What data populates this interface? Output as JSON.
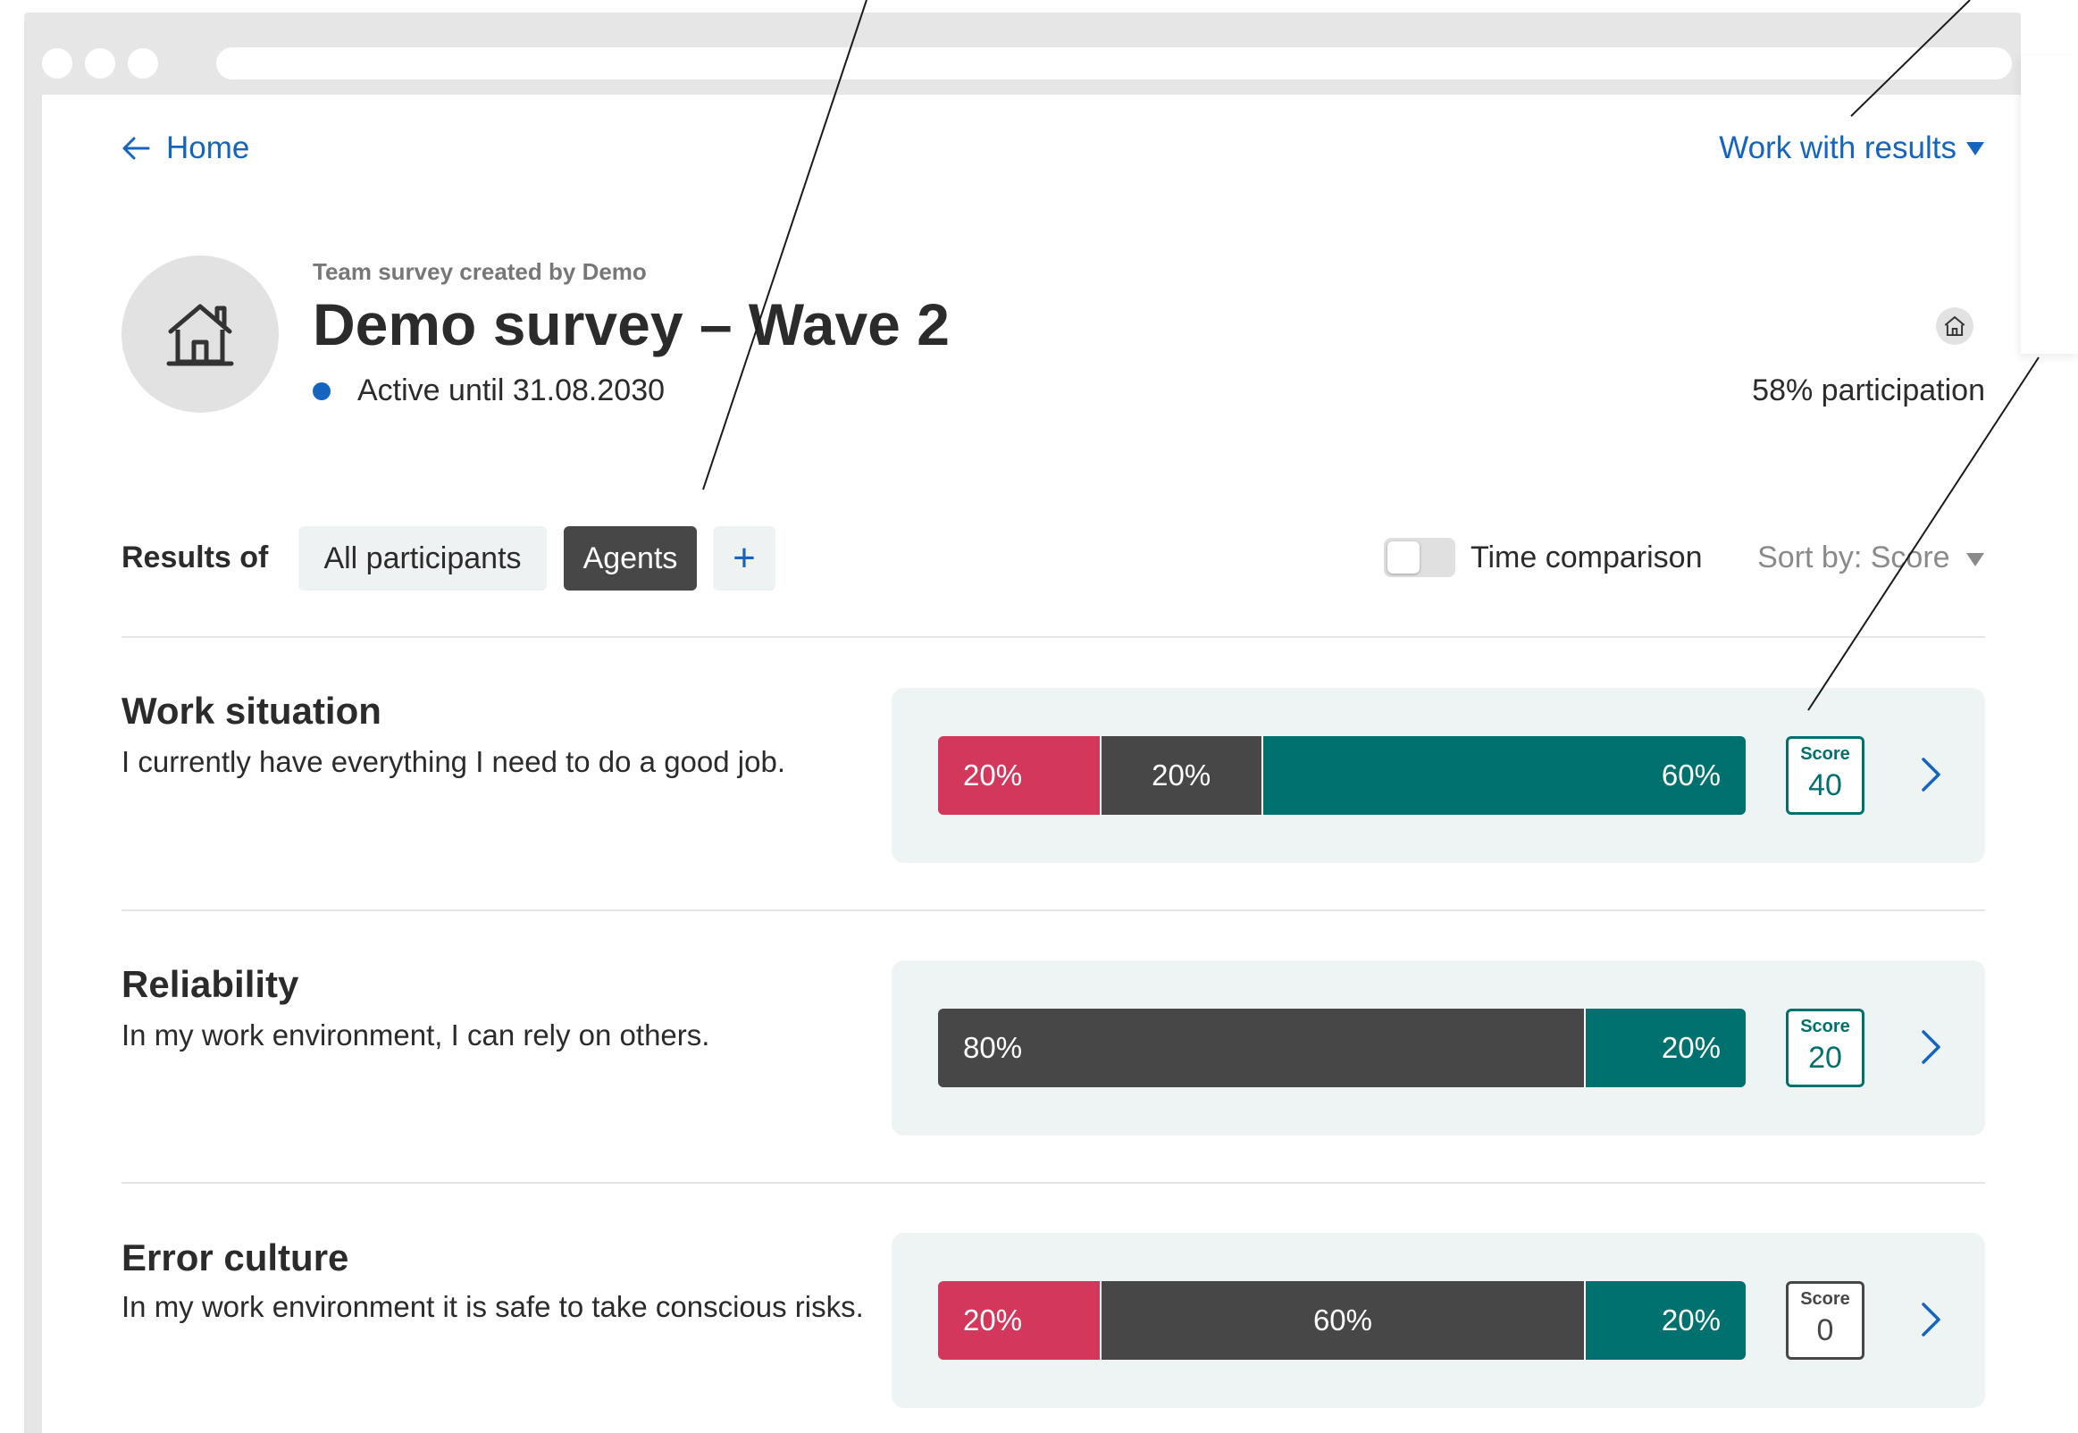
{
  "nav": {
    "back_label": "Home",
    "menu_label": "Work with results"
  },
  "survey": {
    "subtitle": "Team survey created by Demo",
    "title": "Demo survey – Wave 2",
    "status": "Active until 31.08.2030",
    "participation": "58% participation"
  },
  "filters": {
    "label": "Results of",
    "chips": [
      "All participants",
      "Agents"
    ],
    "selected": "Agents",
    "add_symbol": "+",
    "time_comparison_label": "Time comparison",
    "time_comparison_on": false,
    "sort_label": "Sort by: Score"
  },
  "questions": [
    {
      "title": "Work situation",
      "text": "I currently have everything I need to do a good job.",
      "segments": [
        {
          "type": "negative",
          "value": 20,
          "label": "20%"
        },
        {
          "type": "neutral",
          "value": 20,
          "label": "20%"
        },
        {
          "type": "positive",
          "value": 60,
          "label": "60%"
        }
      ],
      "score_label": "Score",
      "score": "40"
    },
    {
      "title": "Reliability",
      "text": "In my work environment, I can rely on others.",
      "segments": [
        {
          "type": "neutral",
          "value": 80,
          "label": "80%"
        },
        {
          "type": "positive",
          "value": 20,
          "label": "20%"
        }
      ],
      "score_label": "Score",
      "score": "20"
    },
    {
      "title": "Error culture",
      "text": "In my work environment it is safe to take conscious risks.",
      "segments": [
        {
          "type": "negative",
          "value": 20,
          "label": "20%"
        },
        {
          "type": "neutral",
          "value": 60,
          "label": "60%"
        },
        {
          "type": "positive",
          "value": 20,
          "label": "20%"
        }
      ],
      "score_label": "Score",
      "score": "0"
    }
  ],
  "colors": {
    "accent": "#1565c0",
    "negative": "#d3385c",
    "neutral": "#474747",
    "positive": "#00716f",
    "panel": "#eef3f3"
  },
  "icons": {
    "back": "arrow-left-icon",
    "dropdown": "caret-down-icon",
    "survey_avatar": "house-icon",
    "detail": "chevron-right-icon"
  }
}
